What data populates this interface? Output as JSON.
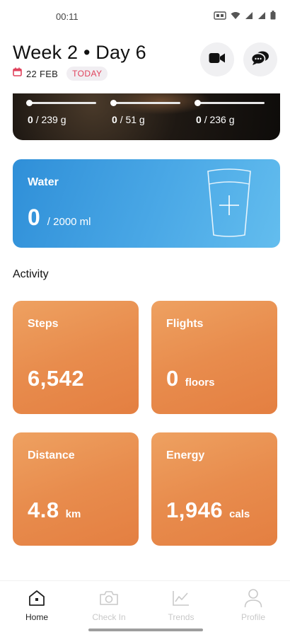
{
  "status_bar": {
    "time": "00:11"
  },
  "header": {
    "title": "Week 2 • Day 6",
    "date": "22 FEB",
    "today_badge": "TODAY"
  },
  "macros": [
    {
      "value": "0",
      "goal": "/ 239 g"
    },
    {
      "value": "0",
      "goal": "/ 51 g"
    },
    {
      "value": "0",
      "goal": "/ 236 g"
    }
  ],
  "water": {
    "label": "Water",
    "value": "0",
    "goal": "/ 2000 ml"
  },
  "activity": {
    "title": "Activity",
    "cards": [
      {
        "label": "Steps",
        "value": "6,542",
        "unit": ""
      },
      {
        "label": "Flights",
        "value": "0",
        "unit": "floors"
      },
      {
        "label": "Distance",
        "value": "4.8",
        "unit": "km"
      },
      {
        "label": "Energy",
        "value": "1,946",
        "unit": "cals"
      }
    ]
  },
  "nav": {
    "items": [
      {
        "label": "Home",
        "icon": "home-icon",
        "active": true
      },
      {
        "label": "Check In",
        "icon": "camera-icon",
        "active": false
      },
      {
        "label": "Trends",
        "icon": "chart-icon",
        "active": false
      },
      {
        "label": "Profile",
        "icon": "person-icon",
        "active": false
      }
    ]
  },
  "colors": {
    "today_badge_text": "#e0425c",
    "water_card": "#4aa8e6",
    "activity_card": "#e88c4d"
  }
}
